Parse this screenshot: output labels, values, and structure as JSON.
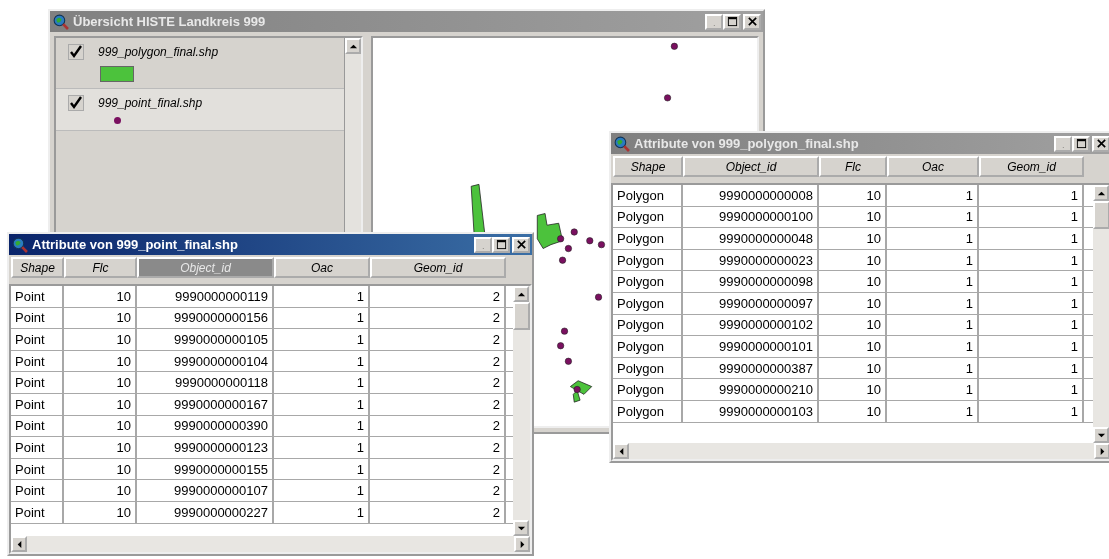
{
  "main_window": {
    "title": "Übersicht HISTE Landkreis 999",
    "active": false,
    "layers": [
      {
        "name": "999_polygon_final.shp",
        "checked": true,
        "selected": false,
        "kind": "polygon",
        "color": "#4cc23c"
      },
      {
        "name": "999_point_final.shp",
        "checked": true,
        "selected": true,
        "kind": "point",
        "color": "#7a1060"
      }
    ]
  },
  "point_table": {
    "title": "Attribute von 999_point_final.shp",
    "active": true,
    "columns": [
      {
        "label": "Shape",
        "selected": false
      },
      {
        "label": "Flc",
        "selected": false
      },
      {
        "label": "Object_id",
        "selected": true
      },
      {
        "label": "Oac",
        "selected": false
      },
      {
        "label": "Geom_id",
        "selected": false
      }
    ],
    "rows": [
      [
        "Point",
        "10",
        "9990000000119",
        "1",
        "2"
      ],
      [
        "Point",
        "10",
        "9990000000156",
        "1",
        "2"
      ],
      [
        "Point",
        "10",
        "9990000000105",
        "1",
        "2"
      ],
      [
        "Point",
        "10",
        "9990000000104",
        "1",
        "2"
      ],
      [
        "Point",
        "10",
        "9990000000118",
        "1",
        "2"
      ],
      [
        "Point",
        "10",
        "9990000000167",
        "1",
        "2"
      ],
      [
        "Point",
        "10",
        "9990000000390",
        "1",
        "2"
      ],
      [
        "Point",
        "10",
        "9990000000123",
        "1",
        "2"
      ],
      [
        "Point",
        "10",
        "9990000000155",
        "1",
        "2"
      ],
      [
        "Point",
        "10",
        "9990000000107",
        "1",
        "2"
      ],
      [
        "Point",
        "10",
        "9990000000227",
        "1",
        "2"
      ]
    ]
  },
  "polygon_table": {
    "title": "Attribute von 999_polygon_final.shp",
    "active": false,
    "columns": [
      {
        "label": "Shape",
        "selected": false
      },
      {
        "label": "Object_id",
        "selected": false
      },
      {
        "label": "Flc",
        "selected": false
      },
      {
        "label": "Oac",
        "selected": false
      },
      {
        "label": "Geom_id",
        "selected": false
      }
    ],
    "rows": [
      [
        "Polygon",
        "9990000000008",
        "10",
        "1",
        "1"
      ],
      [
        "Polygon",
        "9990000000100",
        "10",
        "1",
        "1"
      ],
      [
        "Polygon",
        "9990000000048",
        "10",
        "1",
        "1"
      ],
      [
        "Polygon",
        "9990000000023",
        "10",
        "1",
        "1"
      ],
      [
        "Polygon",
        "9990000000098",
        "10",
        "1",
        "1"
      ],
      [
        "Polygon",
        "9990000000097",
        "10",
        "1",
        "1"
      ],
      [
        "Polygon",
        "9990000000102",
        "10",
        "1",
        "1"
      ],
      [
        "Polygon",
        "9990000000101",
        "10",
        "1",
        "1"
      ],
      [
        "Polygon",
        "9990000000387",
        "10",
        "1",
        "1"
      ],
      [
        "Polygon",
        "9990000000210",
        "10",
        "1",
        "1"
      ],
      [
        "Polygon",
        "9990000000103",
        "10",
        "1",
        "1"
      ]
    ]
  }
}
